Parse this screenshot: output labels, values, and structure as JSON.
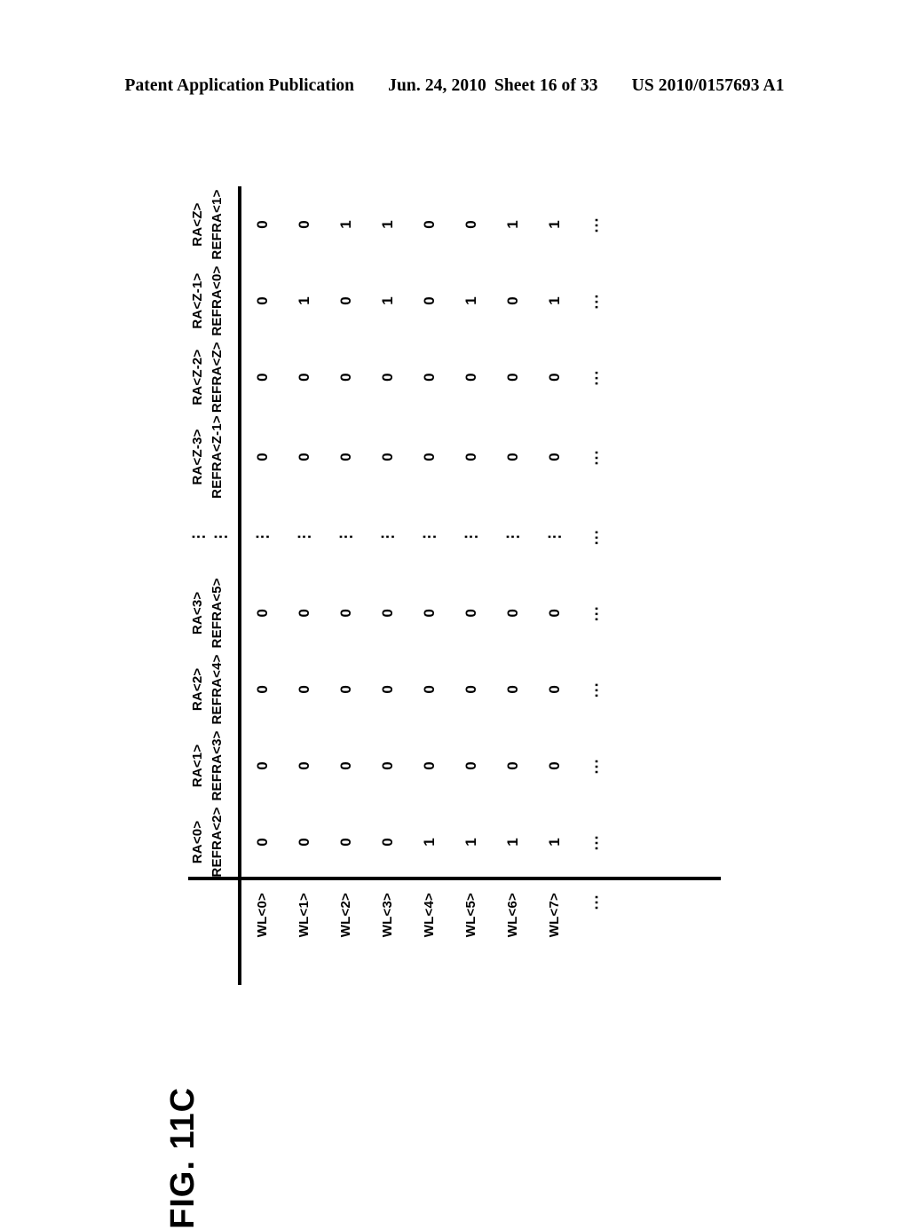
{
  "header": {
    "publication": "Patent Application Publication",
    "date": "Jun. 24, 2010",
    "sheet": "Sheet 16 of 33",
    "number": "US 2010/0157693 A1"
  },
  "figure": {
    "label": "FIG. 11C"
  },
  "table": {
    "row_label_header": "",
    "columns": [
      {
        "line1": "RA<0>",
        "line2": "REFRA<2>"
      },
      {
        "line1": "RA<1>",
        "line2": "REFRA<3>"
      },
      {
        "line1": "RA<2>",
        "line2": "REFRA<4>"
      },
      {
        "line1": "RA<3>",
        "line2": "REFRA<5>"
      },
      {
        "line1": "⋮",
        "line2": "⋮"
      },
      {
        "line1": "RA<Z-3>",
        "line2": "REFRA<Z-1>"
      },
      {
        "line1": "RA<Z-2>",
        "line2": "REFRA<Z>"
      },
      {
        "line1": "RA<Z-1>",
        "line2": "REFRA<0>"
      },
      {
        "line1": "RA<Z>",
        "line2": "REFRA<1>"
      }
    ],
    "rows": [
      {
        "label": "WL<0>",
        "values": [
          "0",
          "0",
          "0",
          "0",
          "⋮",
          "0",
          "0",
          "0",
          "0"
        ]
      },
      {
        "label": "WL<1>",
        "values": [
          "0",
          "0",
          "0",
          "0",
          "⋮",
          "0",
          "0",
          "1",
          "0"
        ]
      },
      {
        "label": "WL<2>",
        "values": [
          "0",
          "0",
          "0",
          "0",
          "⋮",
          "0",
          "0",
          "0",
          "1"
        ]
      },
      {
        "label": "WL<3>",
        "values": [
          "0",
          "0",
          "0",
          "0",
          "⋮",
          "0",
          "0",
          "1",
          "1"
        ]
      },
      {
        "label": "WL<4>",
        "values": [
          "1",
          "0",
          "0",
          "0",
          "⋮",
          "0",
          "0",
          "0",
          "0"
        ]
      },
      {
        "label": "WL<5>",
        "values": [
          "1",
          "0",
          "0",
          "0",
          "⋮",
          "0",
          "0",
          "1",
          "0"
        ]
      },
      {
        "label": "WL<6>",
        "values": [
          "1",
          "0",
          "0",
          "0",
          "⋮",
          "0",
          "0",
          "0",
          "1"
        ]
      },
      {
        "label": "WL<7>",
        "values": [
          "1",
          "0",
          "0",
          "0",
          "⋮",
          "0",
          "0",
          "1",
          "1"
        ]
      },
      {
        "label": "⋯",
        "values": [
          "⋯",
          "⋯",
          "⋯",
          "⋯",
          "⋯",
          "⋯",
          "⋯",
          "⋯",
          "⋯"
        ]
      }
    ]
  }
}
